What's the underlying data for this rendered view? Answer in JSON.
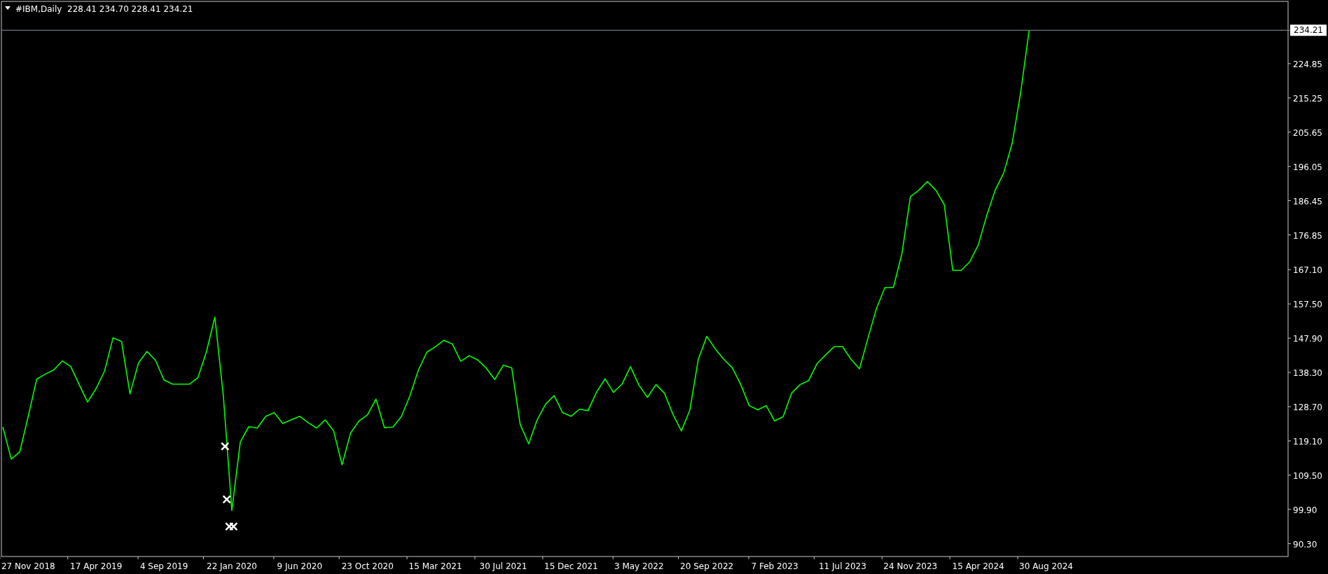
{
  "header": {
    "symbol": "#IBM,Daily",
    "quotes": "228.41 234.70 228.41 234.21"
  },
  "chart": {
    "chart_data": {
      "type": "line",
      "ylim": [
        86.7,
        242.3
      ],
      "categories": [
        null,
        null,
        null,
        "27 Nov 2018",
        null,
        null,
        null,
        null,
        null,
        null,
        null,
        "17 Apr 2019",
        null,
        null,
        null,
        null,
        null,
        null,
        null,
        "4 Sep 2019",
        null,
        null,
        null,
        null,
        null,
        null,
        null,
        "22 Jan 2020",
        null,
        null,
        null,
        null,
        null,
        null,
        null,
        "9 Jun 2020",
        null,
        null,
        null,
        null,
        null,
        null,
        null,
        "23 Oct 2020",
        null,
        null,
        null,
        null,
        null,
        null,
        null,
        "15 Mar 2021",
        null,
        null,
        null,
        null,
        null,
        null,
        null,
        "30 Jul 2021",
        null,
        null,
        null,
        null,
        null,
        null,
        null,
        "15 Dec 2021",
        null,
        null,
        null,
        null,
        null,
        null,
        null,
        "3 May 2022",
        null,
        null,
        null,
        null,
        null,
        null,
        null,
        "20 Sep 2022",
        null,
        null,
        null,
        null,
        null,
        null,
        null,
        "7 Feb 2023",
        null,
        null,
        null,
        null,
        null,
        null,
        null,
        "11 Jul 2023",
        null,
        null,
        null,
        null,
        null,
        null,
        null,
        "24 Nov 2023",
        null,
        null,
        null,
        null,
        null,
        null,
        null,
        "15 Apr 2024",
        null,
        null,
        null,
        null,
        null,
        null,
        null,
        "30 Aug 2024"
      ],
      "series": [
        {
          "color": "#00ff00",
          "values": [
            123,
            114,
            116,
            126,
            136.4,
            137.8,
            139,
            141.5,
            140,
            134.9,
            130,
            133.8,
            138.7,
            148,
            147,
            132.3,
            141,
            144.2,
            141.7,
            136.2,
            135,
            135,
            135,
            136.8,
            144,
            153.8,
            131.7,
            99.6,
            118.8,
            123.1,
            122.7,
            126,
            127,
            124,
            125,
            126,
            124.2,
            122.7,
            125,
            121.9,
            112.4,
            121.3,
            124.7,
            126.4,
            130.8,
            122.8,
            123,
            126,
            131.8,
            139,
            144,
            145.5,
            147.3,
            146.3,
            141.4,
            143,
            141.8,
            139.5,
            136.3,
            140.3,
            139.6,
            123.7,
            118.3,
            125,
            129.4,
            131.8,
            127,
            126,
            128,
            127.6,
            132.8,
            136.5,
            132.7,
            135,
            139.9,
            134.7,
            131.3,
            134.9,
            132.5,
            126.6,
            121.9,
            127.7,
            142,
            148.4,
            144.9,
            142,
            139.6,
            134.9,
            129,
            127.8,
            129,
            124.7,
            125.9,
            132.5,
            134.9,
            136,
            140.8,
            143.2,
            145.5,
            145.5,
            142,
            139.3,
            147.9,
            156.2,
            162.1,
            162.1,
            171.6,
            187.6,
            189.4,
            191.8,
            189.4,
            185.3,
            166.9,
            166.9,
            169.3,
            174,
            182.3,
            189.4,
            194.2,
            202.5,
            216.7,
            234.2,
            null,
            null
          ]
        }
      ],
      "yticks": [
        {
          "value": 224.85,
          "label": "224.85"
        },
        {
          "value": 215.25,
          "label": "215.25"
        },
        {
          "value": 205.65,
          "label": "205.65"
        },
        {
          "value": 196.05,
          "label": "196.05"
        },
        {
          "value": 186.45,
          "label": "186.45"
        },
        {
          "value": 176.85,
          "label": "176.85"
        },
        {
          "value": 167.1,
          "label": "167.10"
        },
        {
          "value": 157.5,
          "label": "157.50"
        },
        {
          "value": 147.9,
          "label": "147.90"
        },
        {
          "value": 138.3,
          "label": "138.30"
        },
        {
          "value": 128.7,
          "label": "128.70"
        },
        {
          "value": 119.1,
          "label": "119.10"
        },
        {
          "value": 109.5,
          "label": "109.50"
        },
        {
          "value": 99.9,
          "label": "99.90"
        },
        {
          "value": 90.3,
          "label": "90.30"
        }
      ],
      "ref_lines": [
        {
          "axis": "y",
          "value": 234.21,
          "label": "234.21"
        }
      ]
    }
  }
}
